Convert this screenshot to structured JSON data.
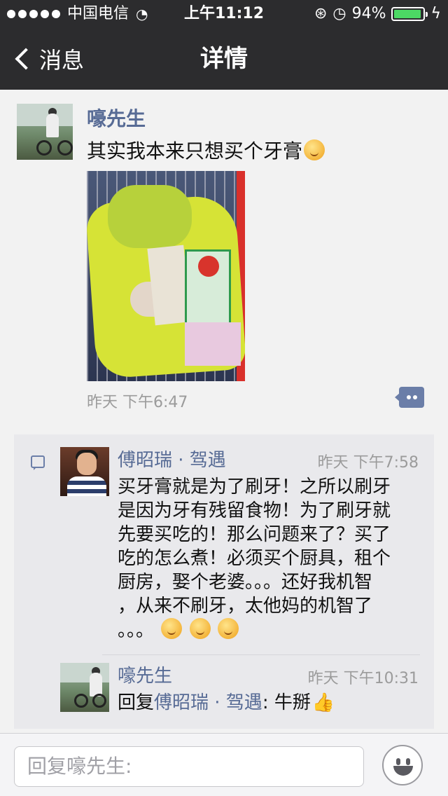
{
  "status_bar": {
    "carrier": "中国电信",
    "time": "上午11:12",
    "battery_pct": "94%",
    "battery_level": 0.94
  },
  "navbar": {
    "back_label": "消息",
    "title": "详情"
  },
  "post": {
    "author": "嚎先生",
    "text": "其实我本来只想买个牙膏",
    "time": "昨天  下午6:47"
  },
  "comments": [
    {
      "author": "傅昭瑞 · 驾遇",
      "time": "昨天  下午7:58",
      "lines": [
        "买牙膏就是为了刷牙！之所以刷牙",
        "是因为牙有残留食物！为了刷牙就",
        "先要买吃的！那么问题来了？买了",
        "吃的怎么煮！必须买个厨具，租个",
        "厨房，娶个老婆。。。还好我机智",
        "，从来不刷牙，太他妈的机智了",
        "。。。"
      ]
    },
    {
      "author": "嚎先生",
      "time": "昨天  下午10:31",
      "reply_prefix": "回复",
      "reply_to": "傅昭瑞 · 驾遇",
      "text": ": 牛掰"
    }
  ],
  "reply_bar": {
    "placeholder": "回复嚎先生:"
  },
  "colors": {
    "nav_bg": "#2c2c2e",
    "link": "#576b95",
    "battery": "#4cd964"
  }
}
